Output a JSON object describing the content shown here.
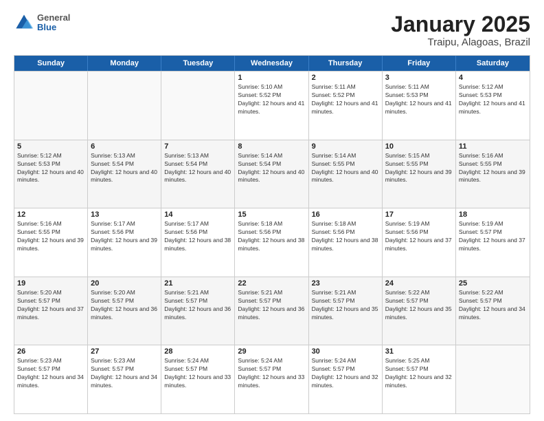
{
  "header": {
    "logo": {
      "general": "General",
      "blue": "Blue"
    },
    "title": "January 2025",
    "location": "Traipu, Alagoas, Brazil"
  },
  "calendar": {
    "days_of_week": [
      "Sunday",
      "Monday",
      "Tuesday",
      "Wednesday",
      "Thursday",
      "Friday",
      "Saturday"
    ],
    "weeks": [
      [
        {
          "day": "",
          "empty": true
        },
        {
          "day": "",
          "empty": true
        },
        {
          "day": "",
          "empty": true
        },
        {
          "day": "1",
          "sunrise": "5:10 AM",
          "sunset": "5:52 PM",
          "daylight": "12 hours and 41 minutes."
        },
        {
          "day": "2",
          "sunrise": "5:11 AM",
          "sunset": "5:52 PM",
          "daylight": "12 hours and 41 minutes."
        },
        {
          "day": "3",
          "sunrise": "5:11 AM",
          "sunset": "5:53 PM",
          "daylight": "12 hours and 41 minutes."
        },
        {
          "day": "4",
          "sunrise": "5:12 AM",
          "sunset": "5:53 PM",
          "daylight": "12 hours and 41 minutes."
        }
      ],
      [
        {
          "day": "5",
          "sunrise": "5:12 AM",
          "sunset": "5:53 PM",
          "daylight": "12 hours and 40 minutes."
        },
        {
          "day": "6",
          "sunrise": "5:13 AM",
          "sunset": "5:54 PM",
          "daylight": "12 hours and 40 minutes."
        },
        {
          "day": "7",
          "sunrise": "5:13 AM",
          "sunset": "5:54 PM",
          "daylight": "12 hours and 40 minutes."
        },
        {
          "day": "8",
          "sunrise": "5:14 AM",
          "sunset": "5:54 PM",
          "daylight": "12 hours and 40 minutes."
        },
        {
          "day": "9",
          "sunrise": "5:14 AM",
          "sunset": "5:55 PM",
          "daylight": "12 hours and 40 minutes."
        },
        {
          "day": "10",
          "sunrise": "5:15 AM",
          "sunset": "5:55 PM",
          "daylight": "12 hours and 39 minutes."
        },
        {
          "day": "11",
          "sunrise": "5:16 AM",
          "sunset": "5:55 PM",
          "daylight": "12 hours and 39 minutes."
        }
      ],
      [
        {
          "day": "12",
          "sunrise": "5:16 AM",
          "sunset": "5:55 PM",
          "daylight": "12 hours and 39 minutes."
        },
        {
          "day": "13",
          "sunrise": "5:17 AM",
          "sunset": "5:56 PM",
          "daylight": "12 hours and 39 minutes."
        },
        {
          "day": "14",
          "sunrise": "5:17 AM",
          "sunset": "5:56 PM",
          "daylight": "12 hours and 38 minutes."
        },
        {
          "day": "15",
          "sunrise": "5:18 AM",
          "sunset": "5:56 PM",
          "daylight": "12 hours and 38 minutes."
        },
        {
          "day": "16",
          "sunrise": "5:18 AM",
          "sunset": "5:56 PM",
          "daylight": "12 hours and 38 minutes."
        },
        {
          "day": "17",
          "sunrise": "5:19 AM",
          "sunset": "5:56 PM",
          "daylight": "12 hours and 37 minutes."
        },
        {
          "day": "18",
          "sunrise": "5:19 AM",
          "sunset": "5:57 PM",
          "daylight": "12 hours and 37 minutes."
        }
      ],
      [
        {
          "day": "19",
          "sunrise": "5:20 AM",
          "sunset": "5:57 PM",
          "daylight": "12 hours and 37 minutes."
        },
        {
          "day": "20",
          "sunrise": "5:20 AM",
          "sunset": "5:57 PM",
          "daylight": "12 hours and 36 minutes."
        },
        {
          "day": "21",
          "sunrise": "5:21 AM",
          "sunset": "5:57 PM",
          "daylight": "12 hours and 36 minutes."
        },
        {
          "day": "22",
          "sunrise": "5:21 AM",
          "sunset": "5:57 PM",
          "daylight": "12 hours and 36 minutes."
        },
        {
          "day": "23",
          "sunrise": "5:21 AM",
          "sunset": "5:57 PM",
          "daylight": "12 hours and 35 minutes."
        },
        {
          "day": "24",
          "sunrise": "5:22 AM",
          "sunset": "5:57 PM",
          "daylight": "12 hours and 35 minutes."
        },
        {
          "day": "25",
          "sunrise": "5:22 AM",
          "sunset": "5:57 PM",
          "daylight": "12 hours and 34 minutes."
        }
      ],
      [
        {
          "day": "26",
          "sunrise": "5:23 AM",
          "sunset": "5:57 PM",
          "daylight": "12 hours and 34 minutes."
        },
        {
          "day": "27",
          "sunrise": "5:23 AM",
          "sunset": "5:57 PM",
          "daylight": "12 hours and 34 minutes."
        },
        {
          "day": "28",
          "sunrise": "5:24 AM",
          "sunset": "5:57 PM",
          "daylight": "12 hours and 33 minutes."
        },
        {
          "day": "29",
          "sunrise": "5:24 AM",
          "sunset": "5:57 PM",
          "daylight": "12 hours and 33 minutes."
        },
        {
          "day": "30",
          "sunrise": "5:24 AM",
          "sunset": "5:57 PM",
          "daylight": "12 hours and 32 minutes."
        },
        {
          "day": "31",
          "sunrise": "5:25 AM",
          "sunset": "5:57 PM",
          "daylight": "12 hours and 32 minutes."
        },
        {
          "day": "",
          "empty": true
        }
      ]
    ]
  }
}
